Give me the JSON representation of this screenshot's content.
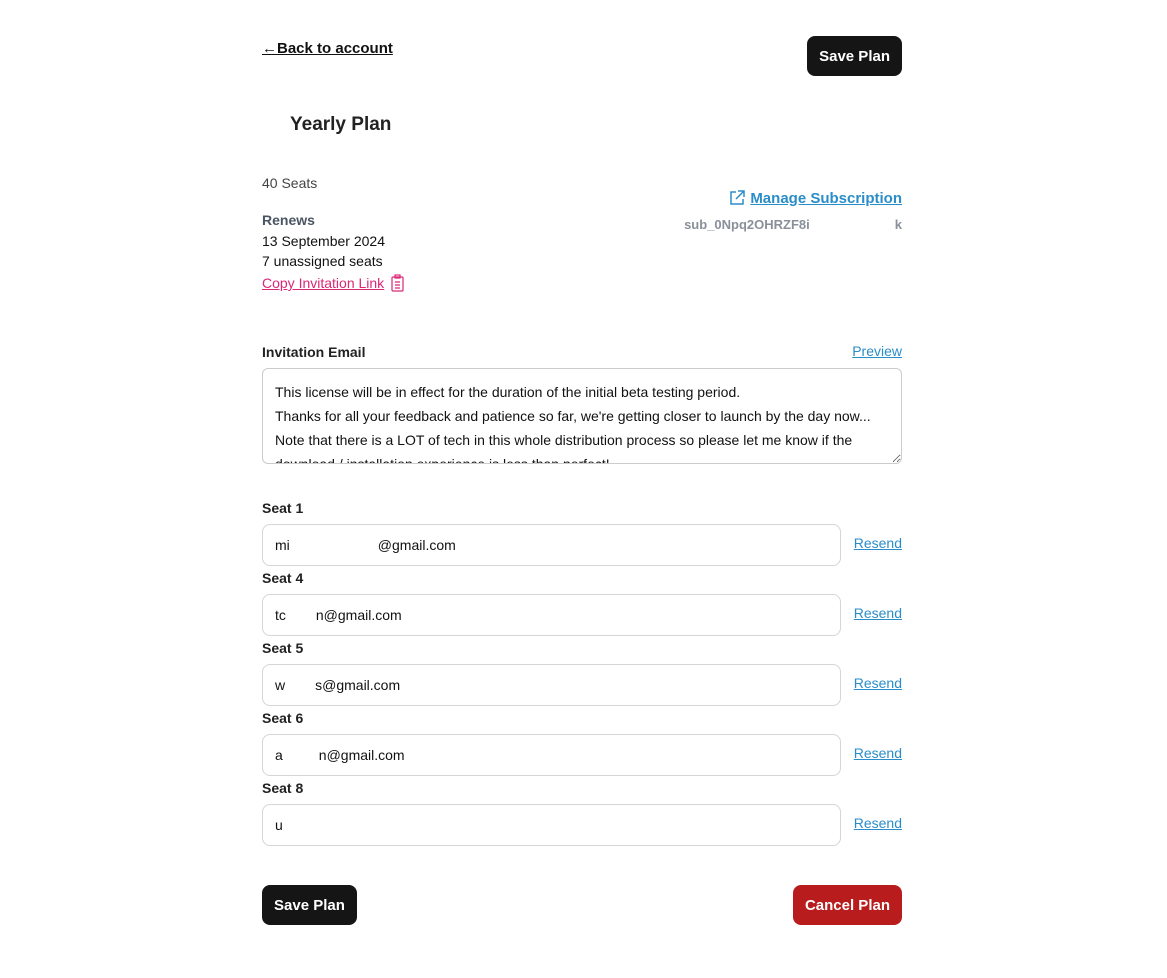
{
  "header": {
    "back_label": "Back to account",
    "back_icon": "arrow-left-icon",
    "save_label": "Save Plan"
  },
  "plan": {
    "title": "Yearly Plan",
    "seats": "40 Seats",
    "renews_label": "Renews",
    "renews_date": "13 September 2024",
    "unassigned": "7 unassigned seats",
    "copy_link_label": "Copy Invitation Link",
    "manage_label": "Manage Subscription",
    "sub_id_prefix": "sub_0Npq2OHRZF8i",
    "sub_id_suffix": "k"
  },
  "invitation": {
    "label": "Invitation Email",
    "preview_label": "Preview",
    "text": "This license will be in effect for the duration of the initial beta testing period.\nThanks for all your feedback and patience so far, we're getting closer to launch by the day now...\nNote that there is a LOT of tech in this whole distribution process so please let me know if the download / installation experience is less than perfect!"
  },
  "seats": [
    {
      "label": "Seat 1",
      "prefix": "mi",
      "suffix": "@gmail.com",
      "resend": "Resend"
    },
    {
      "label": "Seat 4",
      "prefix": "tc",
      "suffix": "n@gmail.com",
      "resend": "Resend"
    },
    {
      "label": "Seat 5",
      "prefix": "w",
      "suffix": "s@gmail.com",
      "resend": "Resend"
    },
    {
      "label": "Seat 6",
      "prefix": "a",
      "suffix": "n@gmail.com",
      "resend": "Resend"
    },
    {
      "label": "Seat 8",
      "prefix": "u",
      "suffix": "",
      "resend": "Resend"
    }
  ],
  "footer": {
    "save_label": "Save Plan",
    "cancel_label": "Cancel Plan"
  },
  "colors": {
    "link": "#2a8dc8",
    "pink": "#db2777",
    "danger": "#b91c1c",
    "dark": "#151515"
  }
}
